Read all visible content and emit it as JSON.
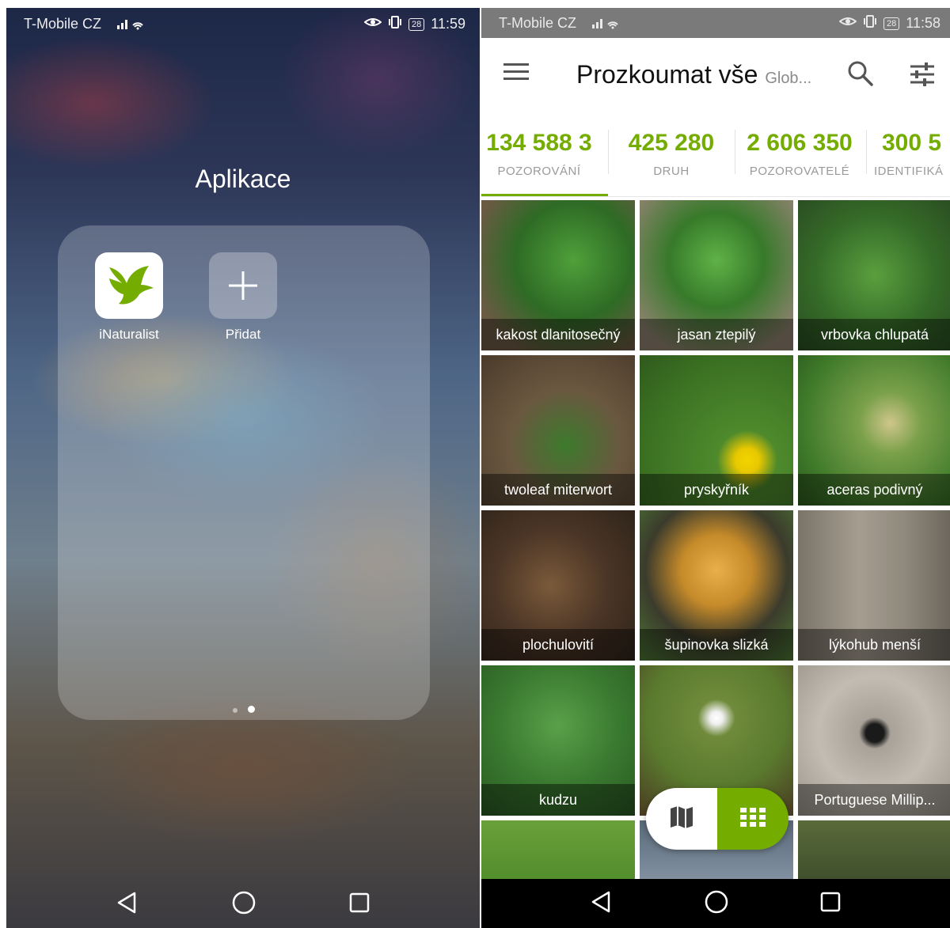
{
  "left_screen": {
    "status": {
      "carrier": "T-Mobile CZ",
      "battery": "28",
      "time": "11:59"
    },
    "folder_title": "Aplikace",
    "apps": [
      {
        "label": "iNaturalist",
        "icon": "bird-icon"
      },
      {
        "label": "Přidat",
        "icon": "plus-icon"
      }
    ]
  },
  "right_screen": {
    "status": {
      "carrier": "T-Mobile CZ",
      "battery": "28",
      "time": "11:58"
    },
    "header": {
      "title": "Prozkoumat vše",
      "subtitle": "Glob..."
    },
    "stats": [
      {
        "value": "134 588 3",
        "label": "POZOROVÁNÍ"
      },
      {
        "value": "425 280",
        "label": "DRUH"
      },
      {
        "value": "2 606 350",
        "label": "POZOROVATELÉ"
      },
      {
        "value": "300 5",
        "label": "IDENTIFIKÁ"
      }
    ],
    "grid": [
      {
        "name": "kakost dlanitosečný"
      },
      {
        "name": "jasan ztepilý"
      },
      {
        "name": "vrbovka chlupatá"
      },
      {
        "name": "twoleaf miterwort"
      },
      {
        "name": "pryskyřník"
      },
      {
        "name": "aceras podivný"
      },
      {
        "name": "plochulovití"
      },
      {
        "name": "šupinovka slizká"
      },
      {
        "name": "lýkohub menší"
      },
      {
        "name": "kudzu"
      },
      {
        "name": ""
      },
      {
        "name": "Portuguese Millip..."
      }
    ]
  },
  "colors": {
    "accent": "#74ac00",
    "appbar": "#ffffff",
    "status_bar_right": "#7a7a7a"
  }
}
